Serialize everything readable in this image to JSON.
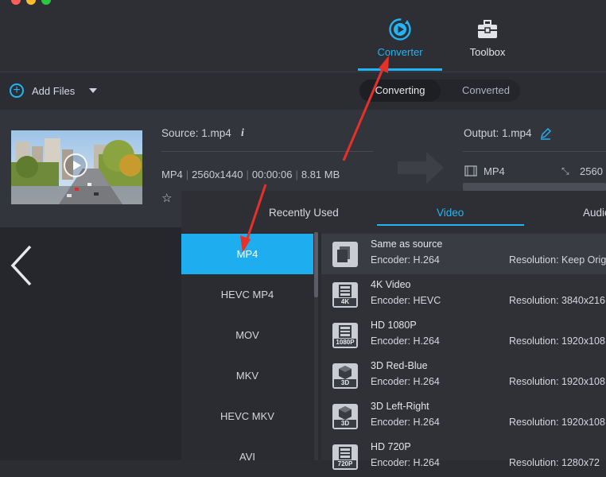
{
  "window": {
    "traffic_lights": [
      "#ff5f57",
      "#febc2e",
      "#28c840"
    ]
  },
  "modes": {
    "converter": "Converter",
    "toolbox": "Toolbox",
    "active": "converter"
  },
  "toolbar": {
    "add_files": "Add Files",
    "segment": {
      "converting": "Converting",
      "converted": "Converted"
    }
  },
  "file": {
    "source": "Source: 1.mp4",
    "format": "MP4",
    "resolution": "2560x1440",
    "duration": "00:00:06",
    "size": "8.81 MB",
    "output": "Output: 1.mp4",
    "output_format": "MP4",
    "output_resolution": "2560"
  },
  "popup": {
    "tabs": [
      "Recently Used",
      "Video",
      "Audio"
    ],
    "active_tab": "Video",
    "formats": [
      "MP4",
      "HEVC MP4",
      "MOV",
      "MKV",
      "HEVC MKV",
      "AVI"
    ],
    "selected_format": "MP4",
    "presets": [
      {
        "name": "Same as source",
        "encoder": "Encoder: H.264",
        "resolution": "Resolution: Keep Orig",
        "badge": "",
        "icon": "copy-icon"
      },
      {
        "name": "4K Video",
        "encoder": "Encoder: HEVC",
        "resolution": "Resolution: 3840x216",
        "badge": "4K",
        "icon": "film-icon"
      },
      {
        "name": "HD 1080P",
        "encoder": "Encoder: H.264",
        "resolution": "Resolution: 1920x108",
        "badge": "1080P",
        "icon": "film-icon"
      },
      {
        "name": "3D Red-Blue",
        "encoder": "Encoder: H.264",
        "resolution": "Resolution: 1920x108",
        "badge": "3D",
        "icon": "cube-icon"
      },
      {
        "name": "3D Left-Right",
        "encoder": "Encoder: H.264",
        "resolution": "Resolution: 1920x108",
        "badge": "3D",
        "icon": "cube-icon"
      },
      {
        "name": "HD 720P",
        "encoder": "Encoder: H.264",
        "resolution": "Resolution: 1280x72",
        "badge": "720P",
        "icon": "film-icon"
      }
    ]
  },
  "colors": {
    "accent": "#1eaef0",
    "annotation_arrow": "#e8302a"
  }
}
